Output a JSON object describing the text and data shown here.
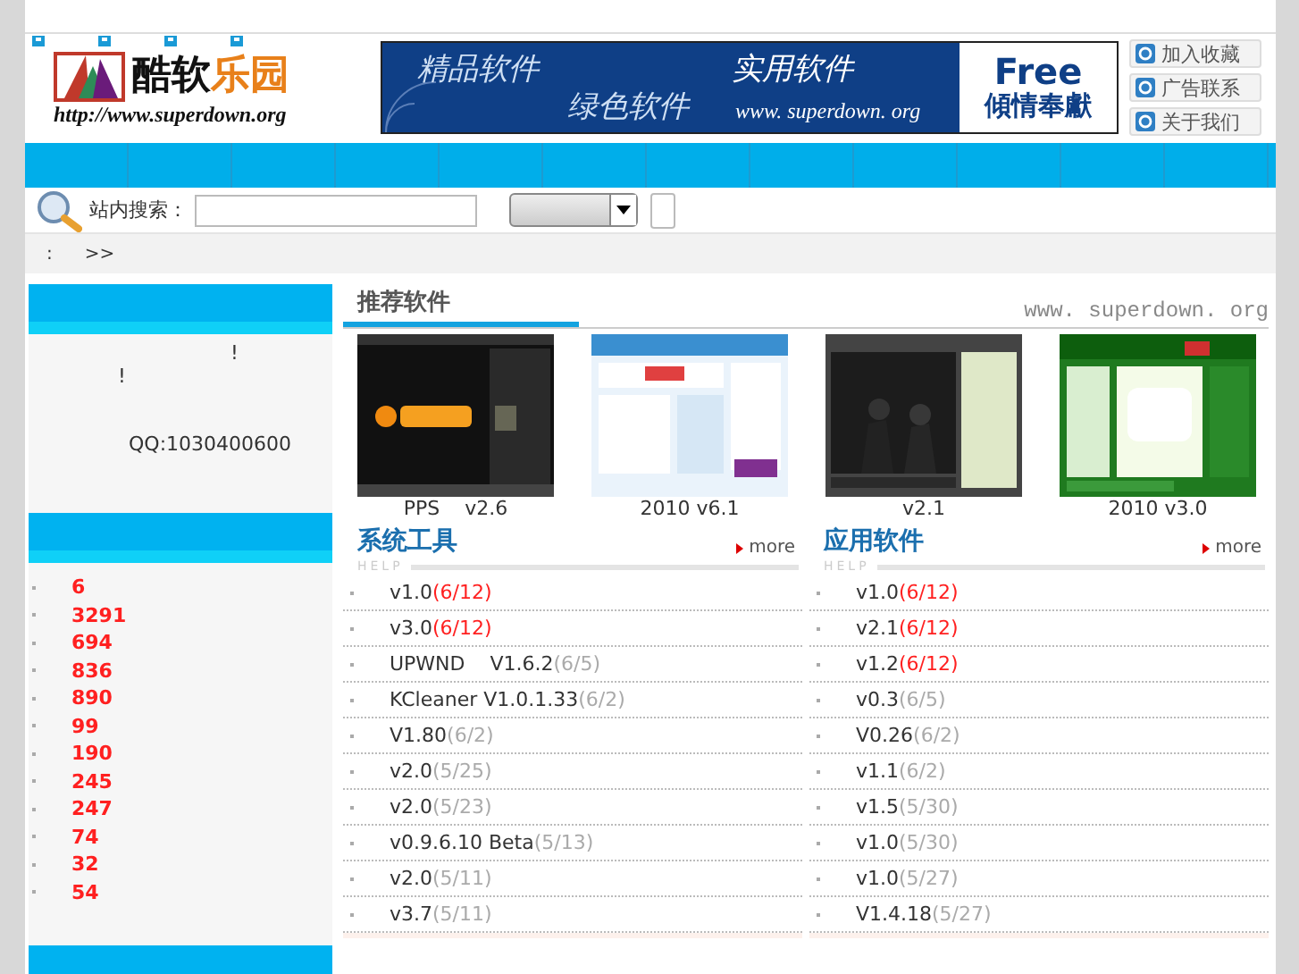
{
  "logo": {
    "title_main": "酷软",
    "title_accent": "乐园",
    "url": "http://www.superdown.org"
  },
  "banner": {
    "slogans": [
      "精品软件",
      "绿色软件",
      "实用软件"
    ],
    "url": "www. superdown. org",
    "badge_title": "Free",
    "badge_text": "傾情奉獻"
  },
  "quick_links": [
    "加入收藏",
    "广告联系",
    "关于我们"
  ],
  "search": {
    "label": "站内搜索："
  },
  "breadcrumb": [
    ":",
    ">>"
  ],
  "sidebar": {
    "notice": [
      "!",
      "!"
    ],
    "contact": "QQ:1030400600",
    "stats": [
      "6",
      "3291",
      "694",
      "836",
      "890",
      "99",
      "190",
      "245",
      "247",
      "74",
      "32",
      "54"
    ]
  },
  "featured": {
    "title": "推荐软件",
    "site": "www. superdown. org",
    "items": [
      {
        "kind": "picture",
        "caption": "PPS    v2.6"
      },
      {
        "kind": "picture",
        "caption": "2010 v6.1"
      },
      {
        "kind": "picture",
        "caption": "v2.1"
      },
      {
        "kind": "picture",
        "caption": "2010 v3.0"
      }
    ]
  },
  "categories": [
    {
      "title": "系统工具",
      "more": "more",
      "help": "HELP",
      "items": [
        {
          "name": "v1.0",
          "date": "(6/12)",
          "new": true
        },
        {
          "name": "v3.0",
          "date": "(6/12)",
          "new": true
        },
        {
          "name": "UPWND    V1.6.2",
          "date": "(6/5)",
          "new": false
        },
        {
          "name": "KCleaner V1.0.1.33",
          "date": "(6/2)",
          "new": false
        },
        {
          "name": "V1.80",
          "date": "(6/2)",
          "new": false
        },
        {
          "name": "v2.0",
          "date": "(5/25)",
          "new": false
        },
        {
          "name": "v2.0",
          "date": "(5/23)",
          "new": false
        },
        {
          "name": "v0.9.6.10 Beta",
          "date": "(5/13)",
          "new": false
        },
        {
          "name": "v2.0",
          "date": "(5/11)",
          "new": false
        },
        {
          "name": "v3.7",
          "date": "(5/11)",
          "new": false
        }
      ]
    },
    {
      "title": "应用软件",
      "more": "more",
      "help": "HELP",
      "items": [
        {
          "name": "v1.0",
          "date": "(6/12)",
          "new": true
        },
        {
          "name": "v2.1",
          "date": "(6/12)",
          "new": true
        },
        {
          "name": "v1.2",
          "date": "(6/12)",
          "new": true
        },
        {
          "name": "v0.3",
          "date": "(6/5)",
          "new": false
        },
        {
          "name": "V0.26",
          "date": "(6/2)",
          "new": false
        },
        {
          "name": "v1.1",
          "date": "(6/2)",
          "new": false
        },
        {
          "name": "v1.5",
          "date": "(5/30)",
          "new": false
        },
        {
          "name": "v1.0",
          "date": "(5/30)",
          "new": false
        },
        {
          "name": "v1.0",
          "date": "(5/27)",
          "new": false
        },
        {
          "name": "V1.4.18",
          "date": "(5/27)",
          "new": false
        }
      ]
    }
  ]
}
